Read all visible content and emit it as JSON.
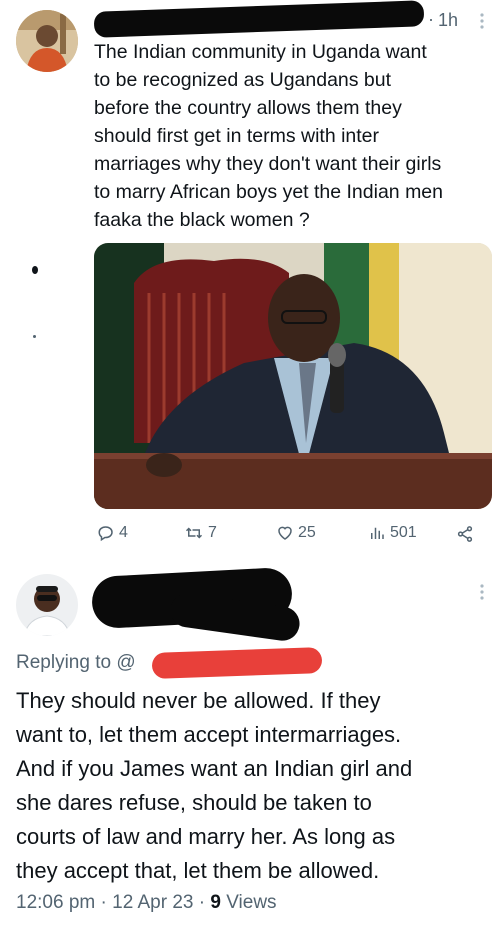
{
  "first_tweet": {
    "time": "1h",
    "text": "The Indian community in Uganda want\nto be recognized as Ugandans but\nbefore the country allows them they\nshould first get in terms with inter\nmarriages why they don't want their girls\nto marry African boys yet the Indian men\nfaaka the black women ?",
    "actions": {
      "replies": "4",
      "retweets": "7",
      "likes": "25",
      "views": "501"
    }
  },
  "second_tweet": {
    "replying_prefix": "Replying to @",
    "text": "They should never be allowed. If they\nwant to, let them accept intermarriages.\nAnd if you James want an Indian girl and\nshe dares refuse, should be taken to\ncourts of law and marry her. As long as\nthey accept that, let them be allowed.",
    "meta_time": "12:06 pm",
    "meta_date": "12 Apr 23",
    "meta_views_count": "9",
    "meta_views_label": "Views",
    "meta_sep": "·"
  },
  "icons": [
    "reply-icon",
    "retweet-icon",
    "like-icon",
    "views-icon",
    "share-icon",
    "more-icon"
  ],
  "colors": {
    "text": "#0f1419",
    "muted": "#536471",
    "redaction": "#0a0a0a",
    "red_redaction": "#e8403a"
  }
}
